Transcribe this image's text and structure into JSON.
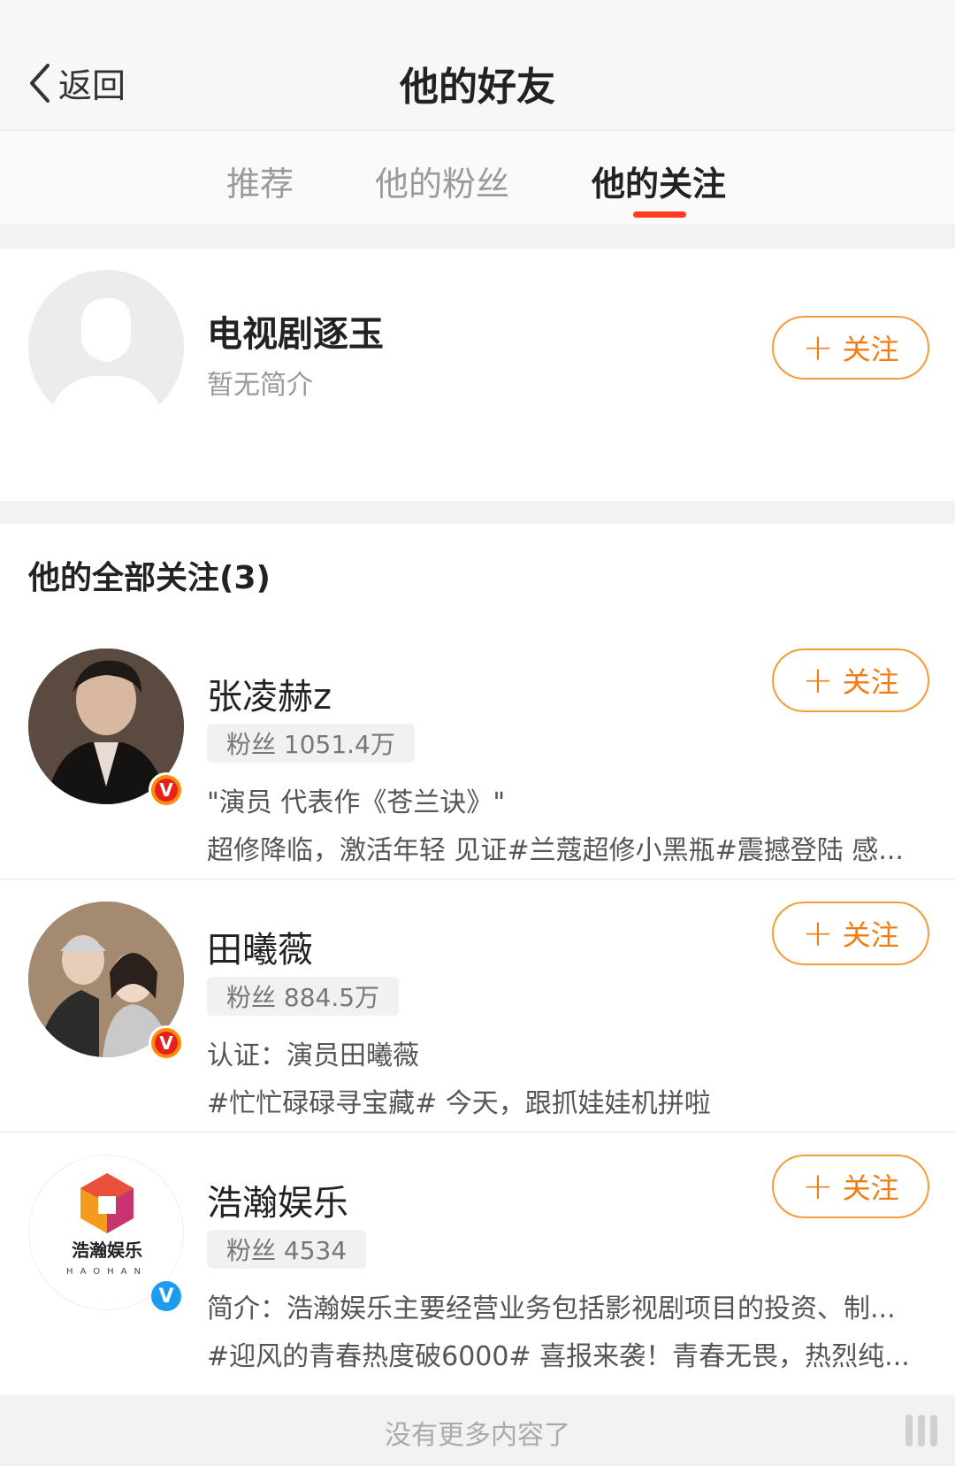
{
  "header": {
    "back_label": "返回",
    "title": "他的好友"
  },
  "tabs": [
    {
      "label": "推荐",
      "active": false
    },
    {
      "label": "他的粉丝",
      "active": false
    },
    {
      "label": "他的关注",
      "active": true
    }
  ],
  "featured": {
    "name": "电视剧逐玉",
    "intro": "暂无简介",
    "follow_label": "关注"
  },
  "section": {
    "title": "他的全部关注(3)"
  },
  "follows": [
    {
      "name": "张凌赫z",
      "fans": "粉丝 1051.4万",
      "line1": "\"演员 代表作《苍兰诀》\"",
      "line2": "超修降临，激活年轻 见证#兰蔻超修小黑瓶#震撼登陆 感...",
      "follow_label": "关注",
      "badge": "V"
    },
    {
      "name": "田曦薇",
      "fans": "粉丝 884.5万",
      "line1": "认证：演员田曦薇",
      "line2": "#忙忙碌碌寻宝藏# 今天，跟抓娃娃机拼啦",
      "follow_label": "关注",
      "badge": "V"
    },
    {
      "name": "浩瀚娱乐",
      "fans": "粉丝 4534",
      "line1": "简介：浩瀚娱乐主要经营业务包括影视剧项目的投资、制...",
      "line2": "#迎风的青春热度破6000# 喜报来袭！青春无畏，热烈纯...",
      "follow_label": "关注",
      "badge": "V",
      "logo_text": "浩瀚娱乐",
      "logo_sub": "HAOHAN"
    }
  ],
  "footer": {
    "text": "没有更多内容了"
  },
  "colors": {
    "accent_orange": "#f07d12",
    "tab_indicator": "#ff3b1f",
    "verified_gold": "#ff8c00",
    "verified_blue": "#1d9bf0"
  }
}
